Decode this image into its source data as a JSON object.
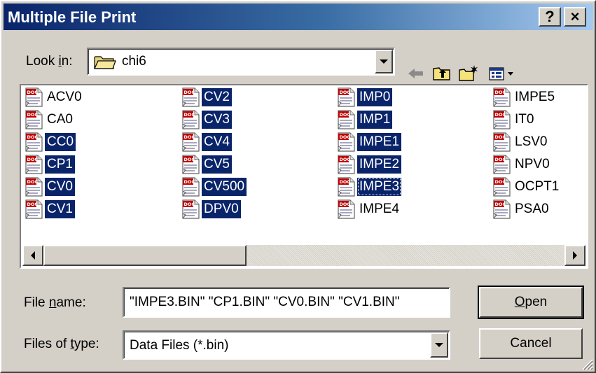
{
  "window": {
    "title": "Multiple File Print",
    "help_btn": "?",
    "close_btn": "×"
  },
  "lookin": {
    "label_pre": "Look ",
    "label_u": "i",
    "label_post": "n:",
    "folder": "chi6",
    "toolbar_icons": [
      "back-arrow-icon",
      "up-folder-icon",
      "new-folder-icon",
      "view-menu-icon"
    ]
  },
  "files": [
    [
      "ACV0",
      "CA0",
      "CC0",
      "CP1",
      "CV0",
      "CV1"
    ],
    [
      "CV2",
      "CV3",
      "CV4",
      "CV5",
      "CV500",
      "DPV0"
    ],
    [
      "IMP0",
      "IMP1",
      "IMPE1",
      "IMPE2",
      "IMPE3",
      "IMPE4"
    ],
    [
      "IMPE5",
      "IT0",
      "LSV0",
      "NPV0",
      "OCPT1",
      "PSA0"
    ]
  ],
  "selected": {
    "c0": [
      2,
      3,
      4,
      5
    ],
    "c1": [
      0,
      1,
      2,
      3,
      4,
      5
    ],
    "c2": [
      0,
      1,
      2,
      3,
      4
    ]
  },
  "filename": {
    "label_pre": "File ",
    "label_u": "n",
    "label_post": "ame:",
    "value": "\"IMPE3.BIN\" \"CP1.BIN\" \"CV0.BIN\" \"CV1.BIN\""
  },
  "filetype": {
    "label_pre": "Files of ",
    "label_u": "t",
    "label_post": "ype:",
    "value": "Data Files (*.bin)"
  },
  "buttons": {
    "open_u": "O",
    "open_rest": "pen",
    "cancel": "Cancel"
  },
  "colors": {
    "selection": "#0a246a",
    "face": "#d4d0c8",
    "title_start": "#0a246a",
    "title_end": "#a6caf0"
  }
}
